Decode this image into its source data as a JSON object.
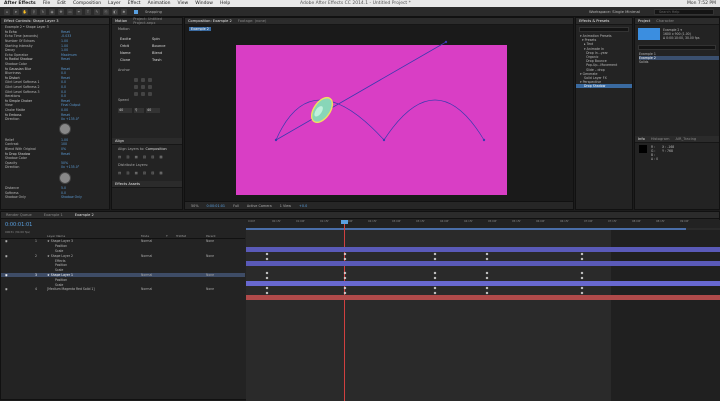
{
  "app": {
    "menu": [
      "After Effects",
      "File",
      "Edit",
      "Composition",
      "Layer",
      "Effect",
      "Animation",
      "View",
      "Window",
      "Help"
    ],
    "window_title": "Adobe After Effects CC 2014.1 - Untitled Project *",
    "clock": "Mon 7:52 PM"
  },
  "toolbar": {
    "snapping_label": "Snapping",
    "workspace_label": "Workspace:",
    "workspace_value": "Single Minimal",
    "search_placeholder": "Search Help"
  },
  "effects_panel": {
    "tab_label": "Effect Controls: Shape Layer 3",
    "breadcrumb": "Example 2 • Shape Layer 3",
    "rows": [
      {
        "label": "fx Echo",
        "value": "Reset",
        "fx": true
      },
      {
        "label": "Echo Time (seconds)",
        "value": "-0.033"
      },
      {
        "label": "Number Of Echoes",
        "value": "1.00"
      },
      {
        "label": "Starting Intensity",
        "value": "1.00"
      },
      {
        "label": "Decay",
        "value": "1.00"
      },
      {
        "label": "Echo Operator",
        "value": "Maximum"
      },
      {
        "label": "fx Radial Shadow",
        "value": "Reset",
        "fx": true
      },
      {
        "label": "Shadow Color",
        "value": ""
      },
      {
        "label": "fx Gaussian Blur",
        "value": "Reset",
        "fx": true
      },
      {
        "label": "Blurriness",
        "value": "0.0"
      },
      {
        "label": "fx Distort",
        "value": "Reset",
        "fx": true
      },
      {
        "label": "Glint Level Softness 1",
        "value": "0.0"
      },
      {
        "label": "Glint Level Softness 2",
        "value": "0.0"
      },
      {
        "label": "Glint Level Softness 3",
        "value": "0.0"
      },
      {
        "label": "Iterations",
        "value": "0.0"
      },
      {
        "label": "fx Simple Choker",
        "value": "Reset",
        "fx": true
      },
      {
        "label": "View",
        "value": "Final Output"
      },
      {
        "label": "Choke Matte",
        "value": "0.00"
      },
      {
        "label": "fx Emboss",
        "value": "Reset",
        "fx": true
      },
      {
        "label": "Direction",
        "value": "0x +135.0°"
      }
    ],
    "rows2": [
      {
        "label": "Relief",
        "value": "1.00"
      },
      {
        "label": "Contrast",
        "value": "100"
      },
      {
        "label": "Blend With Original",
        "value": "0%"
      },
      {
        "label": "fx Drop Shadow",
        "value": "Reset",
        "fx": true
      },
      {
        "label": "Shadow Color",
        "value": ""
      },
      {
        "label": "Opacity",
        "value": "50%"
      },
      {
        "label": "Direction",
        "value": "0x +135.0°"
      }
    ],
    "rows3": [
      {
        "label": "Distance",
        "value": "5.0"
      },
      {
        "label": "Softness",
        "value": "0.0"
      },
      {
        "label": "Shadow Only",
        "value": "Shadow Only"
      }
    ]
  },
  "motion_panel": {
    "tab": "Motion",
    "tab2": "Project: Untitled Project.aepx",
    "section": "Motion",
    "buttons": [
      "Excite",
      "Spin",
      "Orbit",
      "Bounce",
      "Name",
      "Blend",
      "Clone",
      "Trash"
    ],
    "anchor_label": "Anchor",
    "speed_label": "Speed",
    "speed_values": [
      "40",
      "40"
    ],
    "align_tab": "Align",
    "align_to_label": "Align Layers to:",
    "align_to_value": "Composition",
    "distribute_label": "Distribute Layers:",
    "effects_assets_tab": "Effects Assets"
  },
  "composition": {
    "tabs": [
      "Composition: Example 2",
      "Footage: (none)"
    ],
    "comp_button": "Example 2",
    "footer": [
      "50%",
      "0:00:01:01",
      "Full",
      "Active Camera",
      "1 View",
      "+0.0"
    ]
  },
  "right_panel": {
    "tabs": [
      "Effects & Presets",
      "Project",
      "Character"
    ],
    "project_name": "Example 2 ▾",
    "project_info": [
      "1600 x 900 (1.00)",
      "Δ 0:00:10:00, 30.00 fps"
    ],
    "tree": [
      {
        "label": "▾ Animation Presets",
        "sel": false
      },
      {
        "label": "  ▾ Presets",
        "sel": false
      },
      {
        "label": "    ▸ Text",
        "sel": false
      },
      {
        "label": "    ▾ Animate In",
        "sel": false
      },
      {
        "label": "      Drop In...year",
        "sel": false
      },
      {
        "label": "      Organic",
        "sel": false
      },
      {
        "label": "      Drop Bounce",
        "sel": false
      },
      {
        "label": "      Pop-Up...Movement",
        "sel": false
      },
      {
        "label": "      Slide – drop",
        "sel": false
      },
      {
        "label": "▾ Generate",
        "sel": false
      },
      {
        "label": "    Solid Layer FX",
        "sel": false
      },
      {
        "label": "▾ Perspective",
        "sel": false
      },
      {
        "label": "    Drop Shadow",
        "sel": true
      }
    ],
    "project_items": [
      "Example 1",
      "Example 2",
      "Solids"
    ],
    "info_tabs": [
      "Info",
      "Histogram",
      "AIR_Tracing"
    ],
    "info_values": [
      "R :",
      "G :",
      "B :",
      "A : 0",
      "X : -168",
      "Y : 768"
    ]
  },
  "timeline": {
    "tabs": [
      "Render Queue",
      "Example 1",
      "Example 2"
    ],
    "time": "0:00:01:01",
    "fps": "00031 (30.00 fps)",
    "ruler": [
      "0:00f",
      "00:15f",
      "01:00f",
      "01:15f",
      "02:00f",
      "02:15f",
      "03:00f",
      "03:15f",
      "04:00f",
      "04:15f",
      "05:00f",
      "05:15f",
      "06:00f",
      "06:15f",
      "07:00f",
      "07:15f",
      "08:00f",
      "08:15f",
      "09:00f"
    ],
    "layers": [
      {
        "num": "1",
        "name": "★ Shape Layer 3",
        "mode": "Normal",
        "parent": "None",
        "sel": false
      },
      {
        "num": "",
        "name": "Position",
        "mode": "",
        "parent": "",
        "sel": false
      },
      {
        "num": "",
        "name": "Scale",
        "mode": "",
        "parent": "",
        "sel": false
      },
      {
        "num": "2",
        "name": "★ Shape Layer 2",
        "mode": "Normal",
        "parent": "None",
        "sel": false
      },
      {
        "num": "",
        "name": "Effects",
        "mode": "",
        "parent": "",
        "sel": false
      },
      {
        "num": "",
        "name": "Position",
        "mode": "",
        "parent": "",
        "sel": false
      },
      {
        "num": "",
        "name": "Scale",
        "mode": "",
        "parent": "",
        "sel": false
      },
      {
        "num": "3",
        "name": "★ Shape Layer 1",
        "mode": "Normal",
        "parent": "None",
        "sel": true
      },
      {
        "num": "",
        "name": "Position",
        "mode": "",
        "parent": "",
        "sel": false
      },
      {
        "num": "",
        "name": "Scale",
        "mode": "",
        "parent": "",
        "sel": false
      },
      {
        "num": "4",
        "name": "[Medium Magenta Red Solid 1]",
        "mode": "Normal",
        "parent": "None",
        "sel": false
      }
    ],
    "columns": [
      "Layer Name",
      "Mode",
      "T",
      "TrkMat",
      "Parent"
    ]
  },
  "colors": {
    "canvas": "#d93ec5",
    "accent_blue": "#5aa0e0",
    "layer_bar_purple": "#5a5ab8",
    "layer_bar_red": "#b04a4a"
  }
}
